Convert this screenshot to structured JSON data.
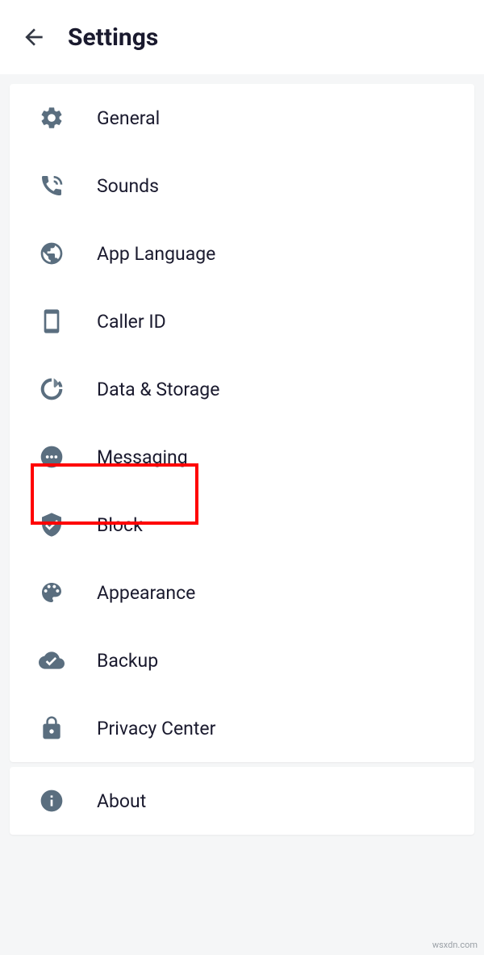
{
  "header": {
    "title": "Settings"
  },
  "groups": [
    {
      "items": [
        {
          "icon": "gear-icon",
          "label": "General"
        },
        {
          "icon": "phone-sound-icon",
          "label": "Sounds"
        },
        {
          "icon": "globe-icon",
          "label": "App Language"
        },
        {
          "icon": "phone-icon",
          "label": "Caller ID"
        },
        {
          "icon": "data-circle-icon",
          "label": "Data & Storage"
        },
        {
          "icon": "message-bubble-icon",
          "label": "Messaging"
        },
        {
          "icon": "shield-check-icon",
          "label": "Block",
          "highlighted": true
        },
        {
          "icon": "palette-icon",
          "label": "Appearance"
        },
        {
          "icon": "cloud-check-icon",
          "label": "Backup"
        },
        {
          "icon": "lock-icon",
          "label": "Privacy Center"
        }
      ]
    },
    {
      "items": [
        {
          "icon": "info-icon",
          "label": "About"
        }
      ]
    }
  ],
  "colors": {
    "icon": "#5a6e7f",
    "text": "#1a1a2e",
    "highlight": "#ff0000"
  },
  "watermark": "wsxdn.com"
}
